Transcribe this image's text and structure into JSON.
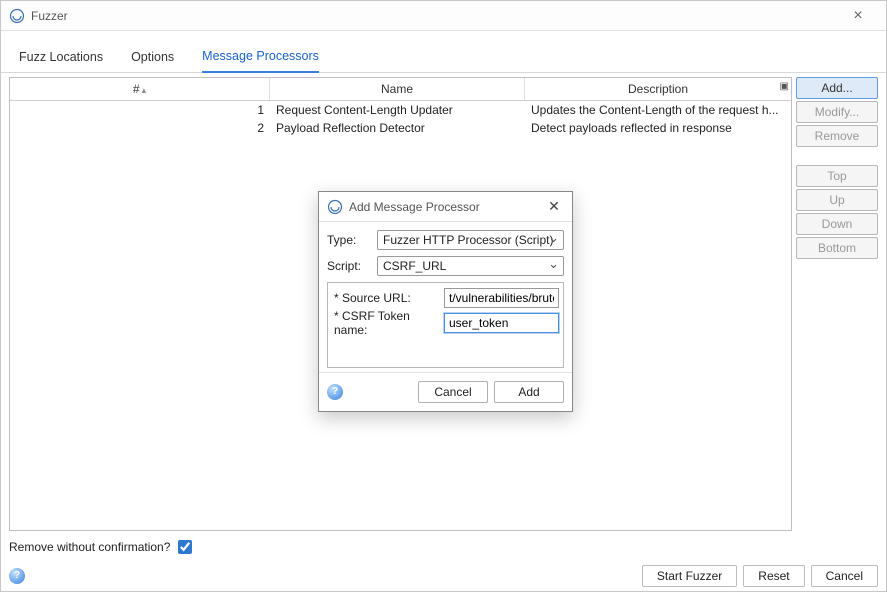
{
  "window": {
    "title": "Fuzzer"
  },
  "tabs": {
    "locations": "Fuzz Locations",
    "options": "Options",
    "processors": "Message Processors"
  },
  "table": {
    "headers": {
      "num": "#",
      "name": "Name",
      "desc": "Description"
    },
    "rows": [
      {
        "num": "1",
        "name": "Request Content-Length Updater",
        "desc": "Updates the Content-Length of the request h..."
      },
      {
        "num": "2",
        "name": "Payload Reflection Detector",
        "desc": "Detect payloads reflected in response"
      }
    ]
  },
  "side_buttons": {
    "add": "Add...",
    "modify": "Modify...",
    "remove": "Remove",
    "top": "Top",
    "up": "Up",
    "down": "Down",
    "bottom": "Bottom"
  },
  "footer": {
    "remove_label": "Remove without confirmation?",
    "remove_checked": true,
    "start": "Start Fuzzer",
    "reset": "Reset",
    "cancel": "Cancel"
  },
  "modal": {
    "title": "Add Message Processor",
    "type_label": "Type:",
    "type_value": "Fuzzer HTTP Processor (Script)",
    "script_label": "Script:",
    "script_value": "CSRF_URL",
    "params": [
      {
        "label": "* Source URL:",
        "value": "t/vulnerabilities/brute"
      },
      {
        "label": "* CSRF Token name:",
        "value": "user_token"
      }
    ],
    "cancel": "Cancel",
    "add": "Add"
  }
}
